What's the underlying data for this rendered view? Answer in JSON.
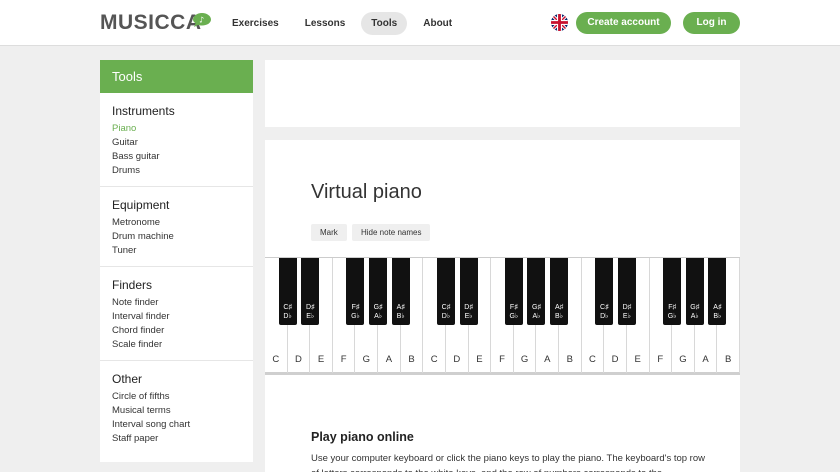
{
  "header": {
    "logo": "MUSICCA",
    "nav": [
      "Exercises",
      "Lessons",
      "Tools",
      "About"
    ],
    "active_nav": "Tools",
    "create_account": "Create account",
    "login": "Log in",
    "language_flag": "uk-flag-icon",
    "brand_color": "#6aaf50"
  },
  "sidebar": {
    "title": "Tools",
    "sections": [
      {
        "title": "Instruments",
        "links": [
          "Piano",
          "Guitar",
          "Bass guitar",
          "Drums"
        ]
      },
      {
        "title": "Equipment",
        "links": [
          "Metronome",
          "Drum machine",
          "Tuner"
        ]
      },
      {
        "title": "Finders",
        "links": [
          "Note finder",
          "Interval finder",
          "Chord finder",
          "Scale finder"
        ]
      },
      {
        "title": "Other",
        "links": [
          "Circle of fifths",
          "Musical terms",
          "Interval song chart",
          "Staff paper"
        ]
      }
    ],
    "active_link": "Piano"
  },
  "main": {
    "title": "Virtual piano",
    "mark_button": "Mark",
    "hide_names_button": "Hide note names",
    "white_keys": [
      "C",
      "D",
      "E",
      "F",
      "G",
      "A",
      "B",
      "C",
      "D",
      "E",
      "F",
      "G",
      "A",
      "B",
      "C",
      "D",
      "E",
      "F",
      "G",
      "A",
      "B"
    ],
    "black_keys": [
      {
        "sharp": "C♯",
        "flat": "D♭"
      },
      {
        "sharp": "D♯",
        "flat": "E♭"
      },
      {
        "sharp": "F♯",
        "flat": "G♭"
      },
      {
        "sharp": "G♯",
        "flat": "A♭"
      },
      {
        "sharp": "A♯",
        "flat": "B♭"
      },
      {
        "sharp": "C♯",
        "flat": "D♭"
      },
      {
        "sharp": "D♯",
        "flat": "E♭"
      },
      {
        "sharp": "F♯",
        "flat": "G♭"
      },
      {
        "sharp": "G♯",
        "flat": "A♭"
      },
      {
        "sharp": "A♯",
        "flat": "B♭"
      },
      {
        "sharp": "C♯",
        "flat": "D♭"
      },
      {
        "sharp": "D♯",
        "flat": "E♭"
      },
      {
        "sharp": "F♯",
        "flat": "G♭"
      },
      {
        "sharp": "G♯",
        "flat": "A♭"
      },
      {
        "sharp": "A♯",
        "flat": "B♭"
      }
    ],
    "subtitle": "Play piano online",
    "paragraph": "Use your computer keyboard or click the piano keys to play the piano. The keyboard's top row of letters corresponds to the white keys, and the row of numbers corresponds to the"
  }
}
